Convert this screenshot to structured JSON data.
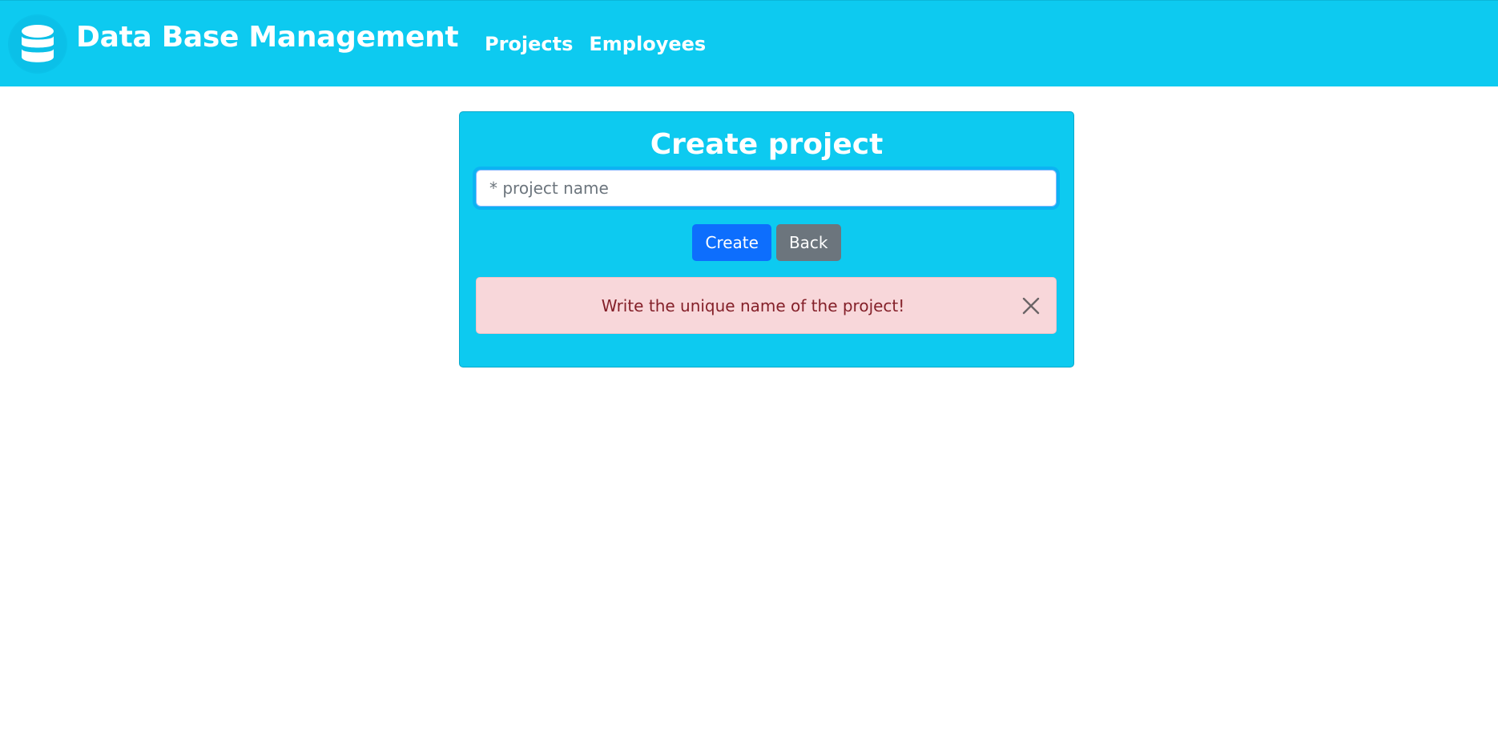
{
  "header": {
    "brand_title": "Data Base Management",
    "logo_icon": "database-icon",
    "nav": [
      {
        "label": "Projects"
      },
      {
        "label": "Employees"
      }
    ]
  },
  "form": {
    "title": "Create project",
    "name_input": {
      "value": "",
      "placeholder": "* project name"
    },
    "create_label": "Create",
    "back_label": "Back"
  },
  "alert": {
    "message": "Write the unique name of the project!",
    "close_icon": "close-icon"
  },
  "colors": {
    "accent": "#0dcaf0",
    "primary_button": "#0d6efd",
    "secondary_button": "#6c757d",
    "alert_background": "#f8d7da",
    "alert_text": "#842029"
  }
}
